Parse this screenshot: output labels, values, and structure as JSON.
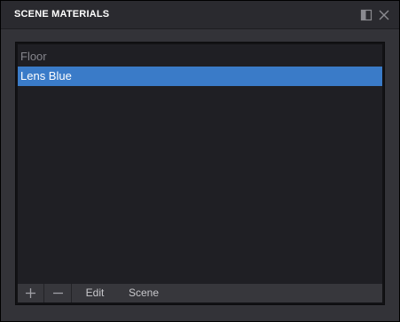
{
  "panel": {
    "title": "SCENE MATERIALS",
    "dock_icon": "dock-panel-icon",
    "close_icon": "close-icon"
  },
  "materials": {
    "items": [
      {
        "label": "Floor",
        "selected": false
      },
      {
        "label": "Lens Blue",
        "selected": true
      }
    ]
  },
  "toolbar": {
    "add_icon": "plus-icon",
    "remove_icon": "minus-icon",
    "edit_label": "Edit",
    "scene_label": "Scene"
  },
  "colors": {
    "selection": "#3a7bc8",
    "panel_background": "#333338",
    "list_background": "#1f1f24"
  }
}
